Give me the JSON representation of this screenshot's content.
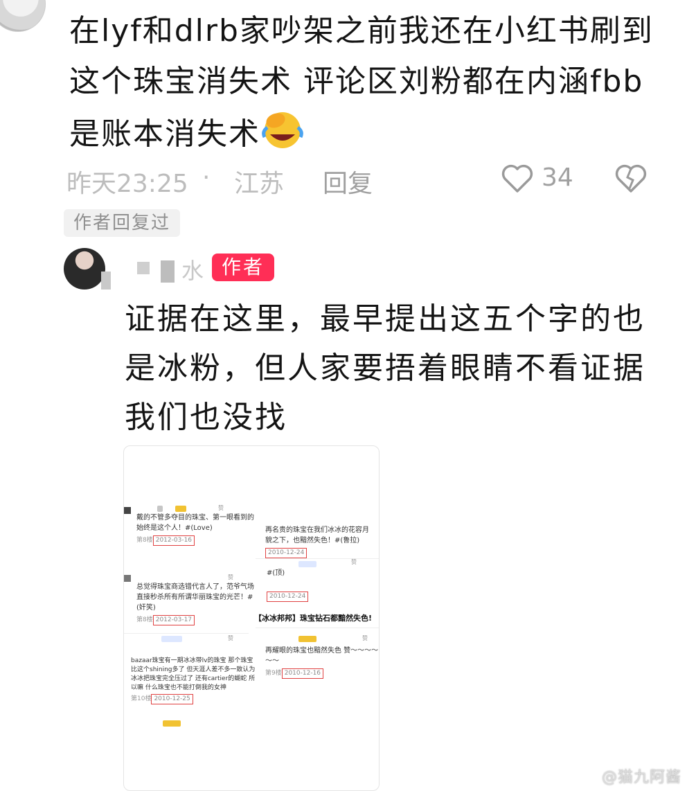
{
  "comment": {
    "text": "在lyf和dlrb家吵架之前我还在小红书刷到这个珠宝消失术 评论区刘粉都在内涵fbb是账本消失术",
    "time": "昨天23:25",
    "separator": "·",
    "location": "江苏",
    "reply_label": "回复",
    "like_count": "34",
    "author_replied_label": "作者回复过"
  },
  "reply": {
    "username": "水",
    "author_badge": "作者",
    "text": "证据在这里，最早提出这五个字的也是冰粉，但人家要捂着眼睛不看证据我们也没找"
  },
  "screenshot": {
    "left": [
      {
        "text": "戴的不管多夺目的珠宝、第一眼看到的始终是这个人！#(Love)",
        "floor": "第8楼",
        "date": "2012-03-16"
      },
      {
        "text": "总觉得珠宝商选错代言人了，范爷气场直接秒杀所有所谓华丽珠宝的光芒！#(奸笑)",
        "floor": "第8楼",
        "date": "2012-03-17"
      },
      {
        "text": "bazaar珠宝有一期冰冰带lv的珠宝 那个珠宝比这个shining多了 但天涯人差不多一致认为冰冰把珠宝完全压过了 还有cartier的蝴蛇 所以嘛 什么珠宝也不能打倒我的女神",
        "floor": "第10楼",
        "date": "2010-12-25"
      }
    ],
    "right": [
      {
        "text": "再名贵的珠宝在我们冰冰的花容月貌之下，也黯然失色！#(鲁拉)",
        "floor": "",
        "date": "2010-12-24"
      },
      {
        "text": "#(顶)",
        "floor": "",
        "date": "2010-12-24"
      },
      {
        "text": "再耀眼的珠宝也黯然失色 赞～～～～～～",
        "floor": "第9楼",
        "date": "2010-12-16"
      }
    ],
    "headline": "【冰冰邦邦】珠宝钻石都黯然失色!",
    "like_label": "赞"
  },
  "watermark": "@猫九阿酱",
  "colors": {
    "accent": "#ff2e56",
    "meta": "#bdbdbd",
    "highlight_box": "#e04040"
  }
}
